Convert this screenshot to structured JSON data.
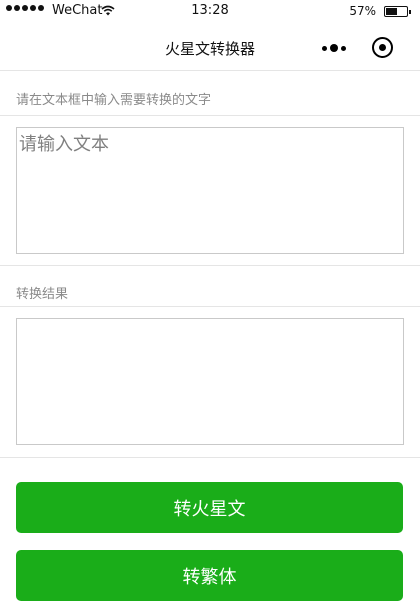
{
  "status_bar": {
    "carrier": "WeChat",
    "time": "13:28",
    "battery_percent": "57%",
    "battery_level": 0.57,
    "signal_dots": 5,
    "icons": [
      "signal-dots-icon",
      "wifi-icon",
      "battery-icon"
    ]
  },
  "nav": {
    "title": "火星文转换器",
    "icons": [
      "more-icon",
      "target-icon"
    ]
  },
  "input_section": {
    "label": "请在文本框中输入需要转换的文字",
    "placeholder": "请输入文本",
    "value": ""
  },
  "result_section": {
    "label": "转换结果",
    "value": ""
  },
  "buttons": {
    "to_martian": "转火星文",
    "to_traditional": "转繁体"
  },
  "colors": {
    "button_green": "#1aad19",
    "label_gray": "#8a8a8a",
    "border_gray": "#c9c9c9"
  }
}
